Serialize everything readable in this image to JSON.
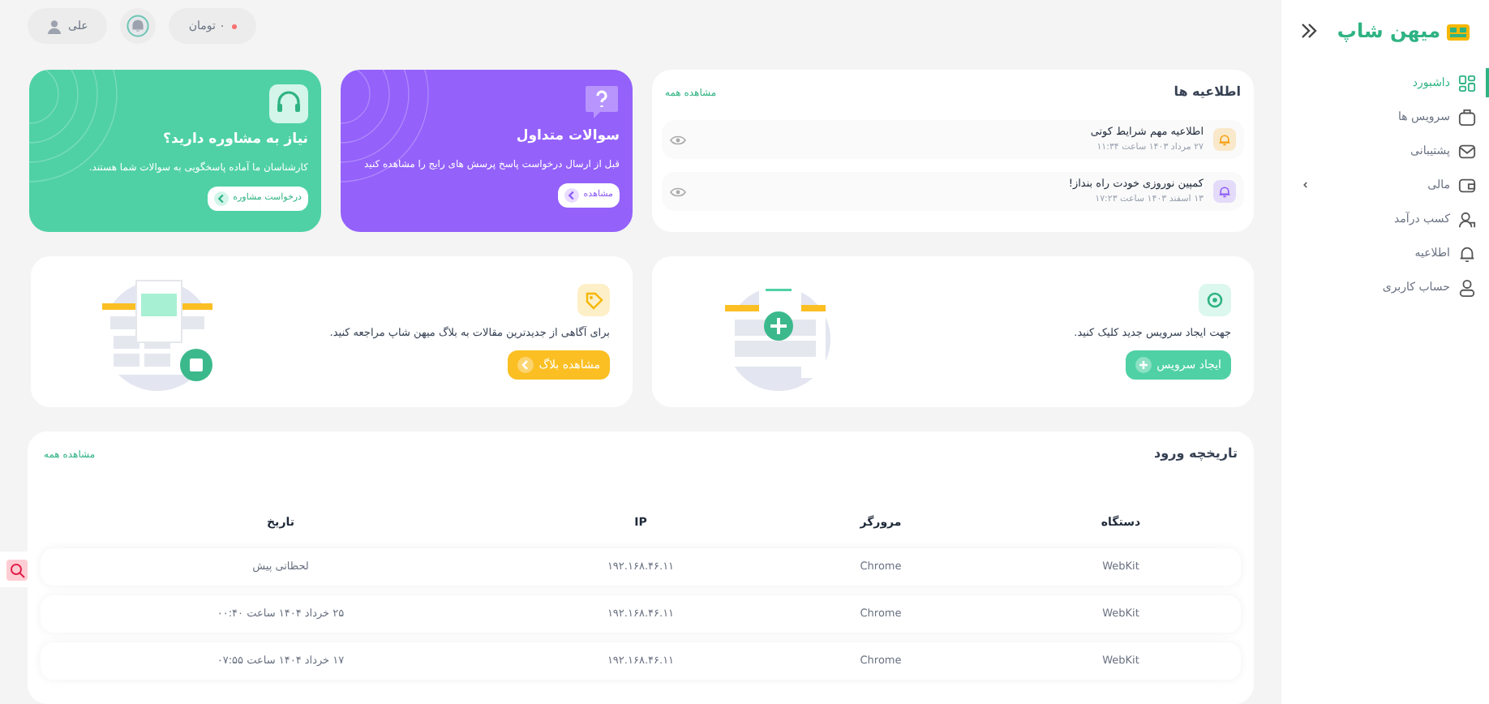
{
  "top_bar": {
    "balance": "۰ تومان",
    "user": "علی"
  },
  "sidebar": {
    "logo": "میهن شاپ",
    "items": [
      {
        "label": "داشبورد",
        "kind": "grid",
        "selected": true,
        "has_submenu": false
      },
      {
        "label": "سرویس ها",
        "kind": "box",
        "selected": false,
        "has_submenu": false
      },
      {
        "label": "پشتیبانی",
        "kind": "mail",
        "selected": false,
        "has_submenu": false
      },
      {
        "label": "مالی",
        "kind": "wallet",
        "selected": false,
        "has_submenu": true
      },
      {
        "label": "کسب درآمد",
        "kind": "users",
        "selected": false,
        "has_submenu": false
      },
      {
        "label": "اطلاعیه",
        "kind": "bell",
        "selected": false,
        "has_submenu": false
      },
      {
        "label": "حساب کاربری",
        "kind": "user",
        "selected": false,
        "has_submenu": false
      }
    ]
  },
  "announcements": {
    "title": "اطلاعیه ها",
    "view_all": "مشاهده همه",
    "items": [
      {
        "title": "اطلاعیه مهم شرایط کوتی",
        "date": "۲۷ مرداد ۱۴۰۳ ساعت ۱۱:۳۴",
        "color": "#f59e0b"
      },
      {
        "title": "کمپین نوروزی خودت راه بنداز!",
        "date": "۱۳ اسفند ۱۴۰۳ ساعت ۱۷:۲۳",
        "color": "#8b5cf6"
      }
    ]
  },
  "promo_cards": [
    {
      "kind": "faq",
      "title": "سوالات متداول",
      "text": "قبل از ارسال درخواست پاسخ پرسش های رایج را مشاهده کنید",
      "button": "مشاهده"
    },
    {
      "kind": "consult",
      "title": "نیاز به مشاوره دارید؟",
      "text": "کارشناسان ما آماده پاسخگویی به سوالات شما هستند.",
      "button": "درخواست مشاوره"
    }
  ],
  "action_cards": [
    {
      "kind": "service",
      "text": "جهت ایجاد سرویس جدید کلیک کنید.",
      "button": "ایجاد سرویس"
    },
    {
      "kind": "blog",
      "text": "برای آگاهی از جدیدترین مقالات به بلاگ میهن شاپ مراجعه کنید.",
      "button": "مشاهده بلاگ"
    }
  ],
  "login_history": {
    "title": "تاریخچه ورود",
    "view_all": "مشاهده همه",
    "columns": [
      "دستگاه",
      "مرورگر",
      "IP",
      "تاریخ"
    ],
    "rows": [
      [
        "WebKit",
        "Chrome",
        "۱۹۲.۱۶۸.۴۶.۱۱",
        "لحظاتی پیش"
      ],
      [
        "WebKit",
        "Chrome",
        "۱۹۲.۱۶۸.۴۶.۱۱",
        "۲۵ خرداد ۱۴۰۴ ساعت ۰۰:۴۰"
      ],
      [
        "WebKit",
        "Chrome",
        "۱۹۲.۱۶۸.۴۶.۱۱",
        "۱۷ خرداد ۱۴۰۴ ساعت ۰۷:۵۵"
      ]
    ]
  }
}
